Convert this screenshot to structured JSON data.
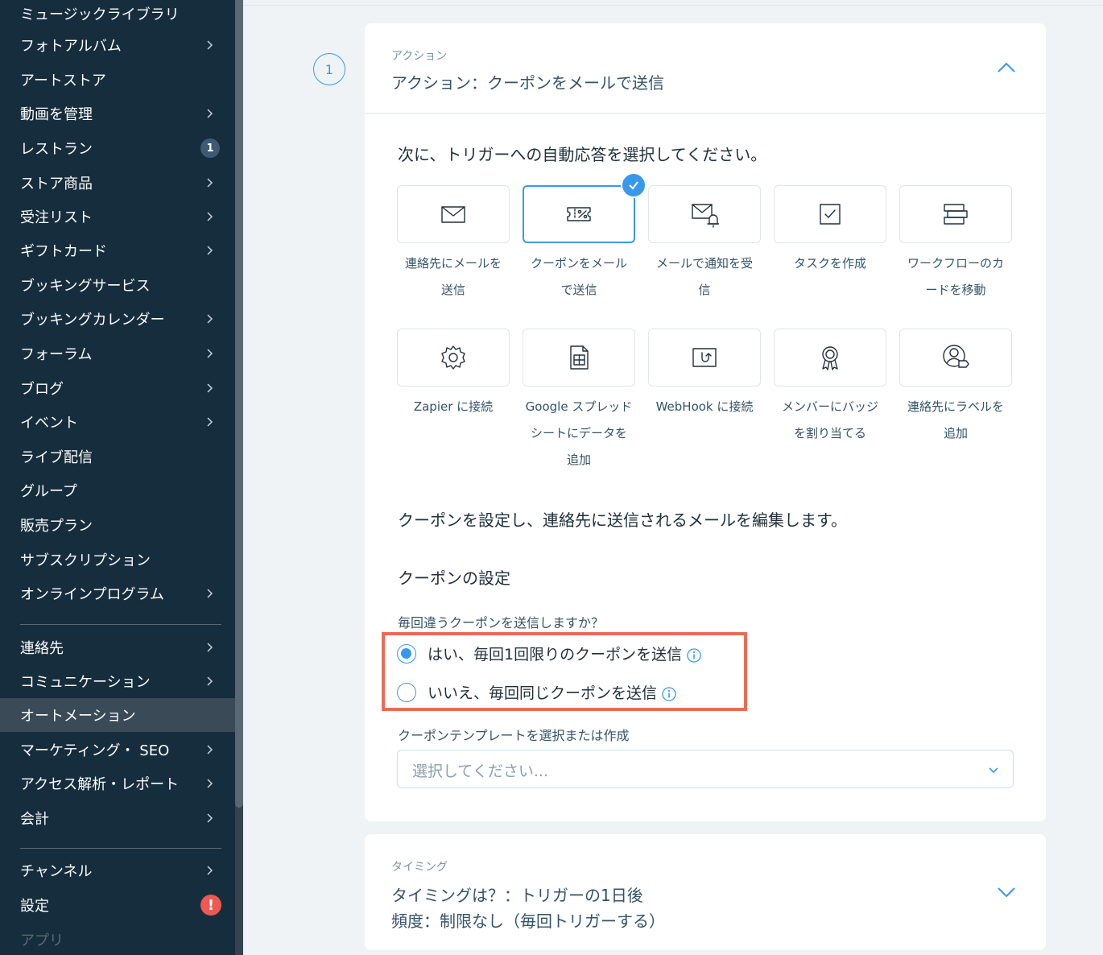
{
  "sidebar": {
    "items": [
      {
        "label": "ミュージックライブラリ"
      },
      {
        "label": "フォトアルバム"
      },
      {
        "label": "アートストア"
      },
      {
        "label": "動画を管理"
      },
      {
        "label": "レストラン",
        "badge": "1"
      },
      {
        "label": "ストア商品"
      },
      {
        "label": "受注リスト"
      },
      {
        "label": "ギフトカード"
      },
      {
        "label": "ブッキングサービス"
      },
      {
        "label": "ブッキングカレンダー"
      },
      {
        "label": "フォーラム"
      },
      {
        "label": "ブログ"
      },
      {
        "label": "イベント"
      },
      {
        "label": "ライブ配信"
      },
      {
        "label": "グループ"
      },
      {
        "label": "販売プラン"
      },
      {
        "label": "サブスクリプション"
      },
      {
        "label": "オンラインプログラム"
      },
      {
        "label": "連絡先"
      },
      {
        "label": "コミュニケーション"
      },
      {
        "label": "オートメーション"
      },
      {
        "label": "マーケティング・ SEO"
      },
      {
        "label": "アクセス解析・レポート"
      },
      {
        "label": "会計"
      },
      {
        "label": "チャンネル"
      },
      {
        "label": "設定",
        "alert": "!"
      },
      {
        "label": "アプリ"
      }
    ]
  },
  "step": {
    "number": "1"
  },
  "action_card": {
    "head_label": "アクション",
    "head_title": "アクション：クーポンをメールで送信",
    "prompt": "次に、トリガーへの自動応答を選択してください。",
    "tiles": [
      {
        "label": "連絡先にメールを送信",
        "icon": "envelope-icon"
      },
      {
        "label": "クーポンをメールで送信",
        "icon": "coupon-icon",
        "selected": true
      },
      {
        "label": "メールで通知を受信",
        "icon": "mail-bell-icon"
      },
      {
        "label": "タスクを作成",
        "icon": "task-check-icon"
      },
      {
        "label": "ワークフローのカードを移動",
        "icon": "workflow-card-icon"
      },
      {
        "label": "Zapier に接続",
        "icon": "gear-icon"
      },
      {
        "label": "Google スプレッドシートにデータを追加",
        "icon": "spreadsheet-icon"
      },
      {
        "label": "WebHook に接続",
        "icon": "webhook-icon"
      },
      {
        "label": "メンバーにバッジを割り当てる",
        "icon": "badge-award-icon"
      },
      {
        "label": "連絡先にラベルを追加",
        "icon": "contact-label-icon"
      }
    ],
    "tile_label_lines": [
      [
        "連絡先にメールを",
        "送信"
      ],
      [
        "クーポンをメール",
        "で送信"
      ],
      [
        "メールで通知を受",
        "信"
      ],
      [
        "タスクを作成"
      ],
      [
        "ワークフローのカ",
        "ードを移動"
      ],
      [
        "Zapier に接続"
      ],
      [
        "Google スプレッド",
        "シートにデータを",
        "追加"
      ],
      [
        "WebHook に接続"
      ],
      [
        "メンバーにバッジ",
        "を割り当てる"
      ],
      [
        "連絡先にラベルを",
        "追加"
      ]
    ],
    "desc": "クーポンを設定し、連絡先に送信されるメールを編集します。",
    "coupon_heading": "クーポンの設定",
    "question": "毎回違うクーポンを送信しますか？",
    "radio_yes": "はい、毎回1回限りのクーポンを送信",
    "radio_no": "いいえ、毎回同じクーポンを送信",
    "selected_option": "yes",
    "template_label": "クーポンテンプレートを選択または作成",
    "template_placeholder": "選択してください..."
  },
  "timing_card": {
    "head_label": "タイミング",
    "line1": "タイミングは？：トリガーの1日後",
    "line2": "頻度：制限なし（毎回トリガーする）"
  },
  "colors": {
    "accent": "#3899ec",
    "sidebar_bg": "#162d3d",
    "highlight": "#ee6a55"
  }
}
